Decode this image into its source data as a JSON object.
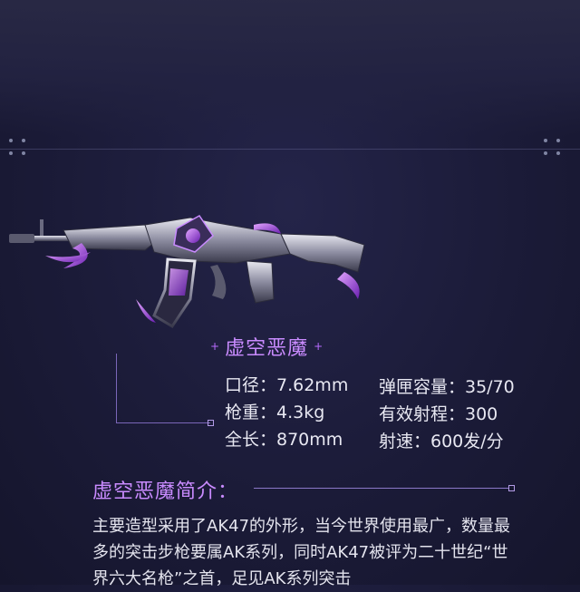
{
  "weapon": {
    "name": "虚空恶魔",
    "decor_plus_left": "+",
    "decor_plus_right": "+",
    "stats_left": [
      {
        "label": "口径：7.62mm"
      },
      {
        "label": "枪重：4.3kg"
      },
      {
        "label": "全长：870mm"
      }
    ],
    "stats_right": [
      {
        "label": "弹匣容量：35/70"
      },
      {
        "label": "有效射程：300"
      },
      {
        "label": "射速：600发/分"
      }
    ]
  },
  "intro": {
    "heading": "虚空恶魔简介：",
    "text": "主要造型采用了AK47的外形，当今世界使用最广，数量最多的突击步枪要属AK系列，同时AK47被评为二十世纪“世界六大名枪”之首，足见AK系列突击"
  },
  "colors": {
    "background": "#1b1b38",
    "accent_purple": "#c98bff",
    "text": "#e6e6f0"
  }
}
